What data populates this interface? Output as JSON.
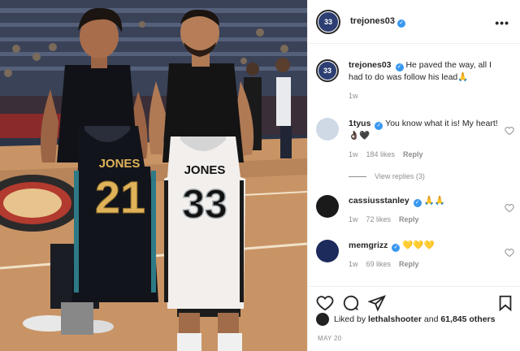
{
  "post": {
    "username": "trejones03",
    "avatar_text": "33",
    "more_icon": "more-horizontal-icon",
    "photo_jerseys": [
      {
        "team": "JONES",
        "number": "21"
      },
      {
        "team": "JONES",
        "number": "33"
      }
    ]
  },
  "caption": {
    "username": "trejones03",
    "text": "He paved the way, all I had to do was follow his lead",
    "emoji": "🙏",
    "time": "1w"
  },
  "comments": [
    {
      "username": "1tyus",
      "verified": true,
      "text": "You know what it is! My heart!",
      "emoji": "👌🏿🖤",
      "time": "1w",
      "likes": "184 likes",
      "reply": "Reply",
      "view_replies": "View replies (3)"
    },
    {
      "username": "cassiusstanley",
      "verified": true,
      "text": "",
      "emoji": "🙏🙏",
      "time": "1w",
      "likes": "72 likes",
      "reply": "Reply"
    },
    {
      "username": "memgrizz",
      "verified": true,
      "text": "",
      "emoji": "💛💛💛",
      "time": "1w",
      "likes": "69 likes",
      "reply": "Reply"
    }
  ],
  "actions": {
    "like_icon": "heart-icon",
    "comment_icon": "comment-icon",
    "share_icon": "send-icon",
    "save_icon": "bookmark-icon"
  },
  "likes": {
    "prefix": "Liked by",
    "user": "lethalshooter",
    "middle": "and",
    "count": "61,845 others"
  },
  "date": "MAY 20",
  "colors": {
    "verified": "#3897f0",
    "muted": "#8e8e8e",
    "text": "#262626",
    "grizzlies_navy": "#1a1f2e",
    "grizzlies_gold": "#e0b35a",
    "spurs_silver": "#c4ced4"
  }
}
